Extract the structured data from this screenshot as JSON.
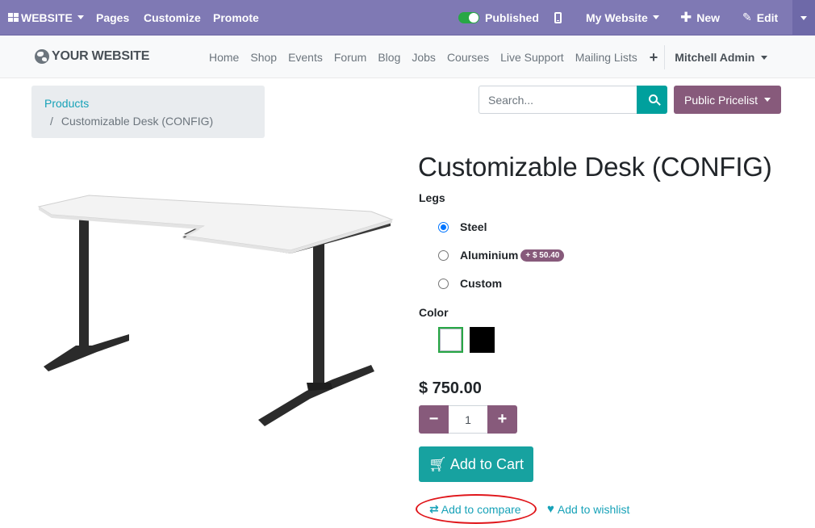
{
  "admin_bar": {
    "website_menu": "WEBSITE",
    "pages": "Pages",
    "customize": "Customize",
    "promote": "Promote",
    "published": "Published",
    "my_website": "My Website",
    "new": "New",
    "edit": "Edit"
  },
  "site_nav": {
    "logo": "YOUR WEBSITE",
    "links": [
      "Home",
      "Shop",
      "Events",
      "Forum",
      "Blog",
      "Jobs",
      "Courses",
      "Live Support",
      "Mailing Lists"
    ],
    "add_symbol": "+",
    "user": "Mitchell Admin"
  },
  "breadcrumb": {
    "parent": "Products",
    "separator": "/",
    "current": "Customizable Desk (CONFIG)"
  },
  "search": {
    "placeholder": "Search..."
  },
  "pricelist": "Public Pricelist",
  "product": {
    "title": "Customizable Desk (CONFIG)",
    "legs_label": "Legs",
    "legs_options": [
      {
        "label": "Steel",
        "selected": true
      },
      {
        "label": "Aluminium",
        "extra": "+ $ 50.40",
        "selected": false
      },
      {
        "label": "Custom",
        "selected": false
      }
    ],
    "color_label": "Color",
    "colors": [
      {
        "name": "White",
        "hex": "#ffffff",
        "selected": true
      },
      {
        "name": "Black",
        "hex": "#000000",
        "selected": false
      }
    ],
    "price": "$ 750.00",
    "quantity": "1",
    "qty_minus": "−",
    "qty_plus": "+",
    "add_to_cart": "Add to Cart",
    "add_to_compare": "Add to compare",
    "add_to_wishlist": "Add to wishlist"
  },
  "theme": {
    "admin_bar_color": "#7f79b4",
    "primary_purple": "#875a7b",
    "accent_teal": "#00a09d",
    "link_color": "#17a2b8",
    "highlight_red": "#e0161b"
  }
}
